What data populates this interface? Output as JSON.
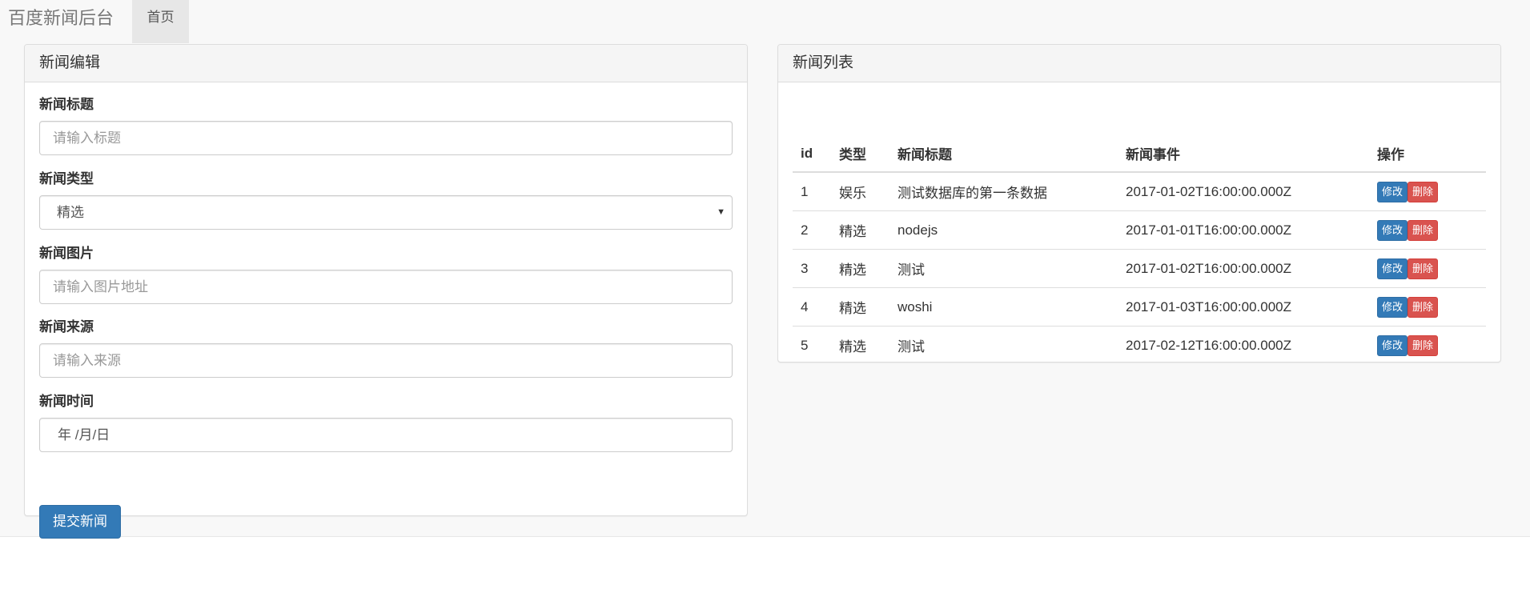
{
  "navbar": {
    "brand": "百度新闻后台",
    "home": "首页"
  },
  "edit_panel": {
    "heading": "新闻编辑",
    "title": {
      "label": "新闻标题",
      "placeholder": "请输入标题"
    },
    "type": {
      "label": "新闻类型",
      "value": "精选"
    },
    "image": {
      "label": "新闻图片",
      "placeholder": "请输入图片地址"
    },
    "source": {
      "label": "新闻来源",
      "placeholder": "请输入来源"
    },
    "time": {
      "label": "新闻时间",
      "value": "年 /月/日"
    },
    "submit_label": "提交新闻"
  },
  "list_panel": {
    "heading": "新闻列表",
    "columns": [
      "id",
      "类型",
      "新闻标题",
      "新闻事件",
      "操作"
    ],
    "edit_label": "修改",
    "delete_label": "删除",
    "rows": [
      {
        "id": "1",
        "type": "娱乐",
        "title": "测试数据库的第一条数据",
        "time": "2017-01-02T16:00:00.000Z"
      },
      {
        "id": "2",
        "type": "精选",
        "title": "nodejs",
        "time": "2017-01-01T16:00:00.000Z"
      },
      {
        "id": "3",
        "type": "精选",
        "title": "测试",
        "time": "2017-01-02T16:00:00.000Z"
      },
      {
        "id": "4",
        "type": "精选",
        "title": "woshi",
        "time": "2017-01-03T16:00:00.000Z"
      },
      {
        "id": "5",
        "type": "精选",
        "title": "测试",
        "time": "2017-02-12T16:00:00.000Z"
      }
    ]
  },
  "colors": {
    "primary": "#337ab7",
    "danger": "#d9534f",
    "page_bg": "#f8f8f8"
  }
}
